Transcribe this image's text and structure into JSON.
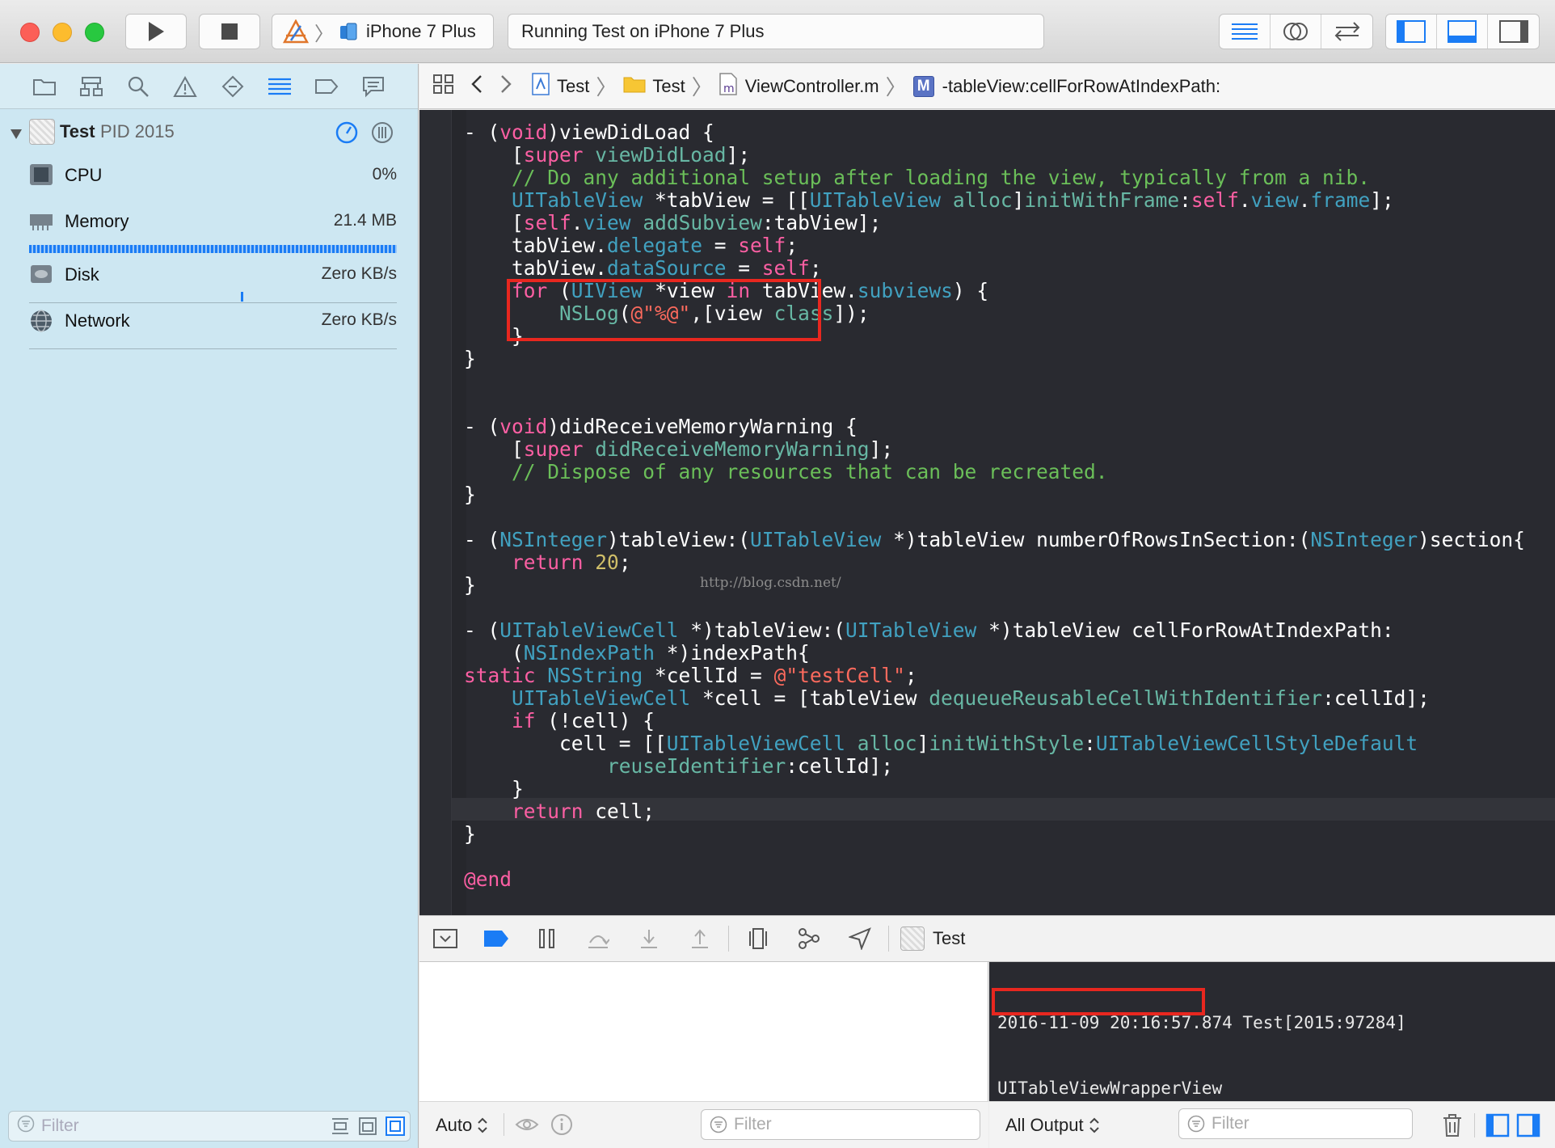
{
  "toolbar": {
    "scheme_device": "iPhone 7 Plus",
    "activity_status": "Running Test on iPhone 7 Plus"
  },
  "navigator": {
    "process_name": "Test",
    "process_pid": "PID 2015",
    "gauges": [
      {
        "label": "CPU",
        "value": "0%"
      },
      {
        "label": "Memory",
        "value": "21.4 MB"
      },
      {
        "label": "Disk",
        "value": "Zero KB/s"
      },
      {
        "label": "Network",
        "value": "Zero KB/s"
      }
    ],
    "filter_placeholder": "Filter"
  },
  "jumpbar": {
    "project": "Test",
    "group": "Test",
    "file": "ViewController.m",
    "method_badge": "M",
    "method": "-tableView:cellForRowAtIndexPath:"
  },
  "editor": {
    "watermark": "http://blog.csdn.net/"
  },
  "debug_bar": {
    "process": "Test"
  },
  "variables": {
    "scope": "Auto",
    "filter_placeholder": "Filter"
  },
  "console": {
    "log_line": "2016-11-09 20:16:57.874 Test[2015:97284]",
    "output_line": "UITableViewWrapperView",
    "output_mode": "All Output",
    "filter_placeholder": "Filter"
  },
  "colors": {
    "accent_blue": "#1a7cf5",
    "highlight_red": "#e8271f",
    "editor_bg": "#292a30",
    "navigator_bg": "#cde7f2"
  }
}
